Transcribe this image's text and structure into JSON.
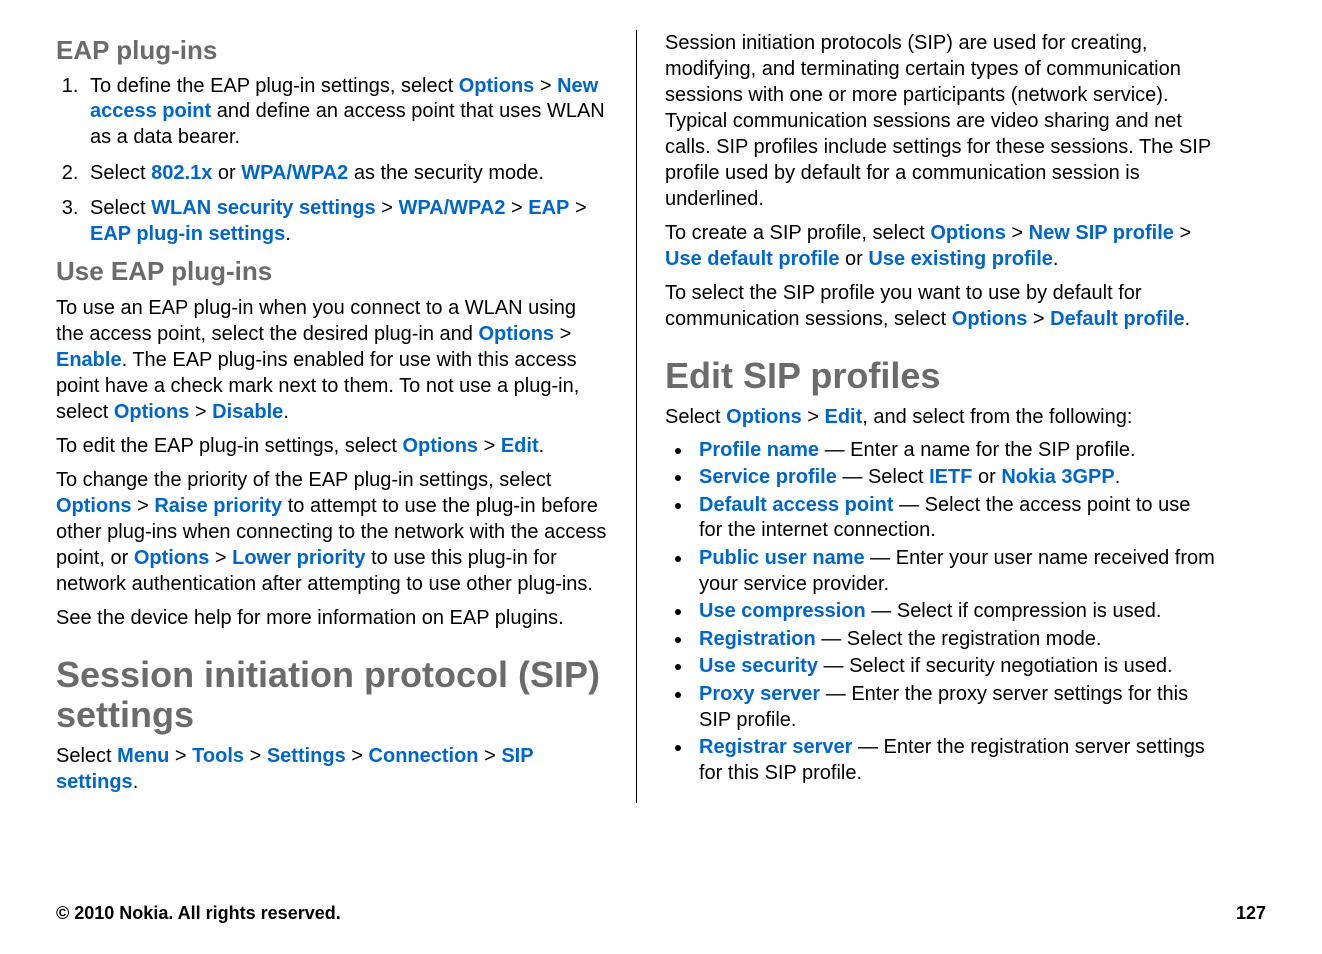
{
  "left": {
    "h1": "EAP plug-ins",
    "steps": [
      {
        "pre": "To define the EAP plug-in settings, select ",
        "b1": "Options",
        "mid1": "  >  ",
        "b2": "New access point",
        "post": " and define an access point that uses WLAN as a data bearer."
      },
      {
        "pre": "Select ",
        "b1": "802.1x",
        "mid1": " or ",
        "b2": "WPA/WPA2",
        "post": " as the security mode."
      },
      {
        "pre": "Select ",
        "b1": "WLAN security settings",
        "mid1": "  >  ",
        "b2": "WPA/WPA2",
        "mid2": "  >  ",
        "b3": "EAP",
        "mid3": "  >  ",
        "b4": "EAP plug-in settings",
        "post": "."
      }
    ],
    "h2": "Use EAP plug-ins",
    "p1": {
      "t1": "To use an EAP plug-in when you connect to a WLAN using the access point, select the desired plug-in and ",
      "b1": "Options",
      "t2": "  >  ",
      "b2": "Enable",
      "t3": ". The EAP plug-ins enabled for use with this access point have a check mark next to them. To not use a plug-in, select ",
      "b3": "Options",
      "t4": "  >  ",
      "b4": "Disable",
      "t5": "."
    },
    "p2": {
      "t1": "To edit the EAP plug-in settings, select ",
      "b1": "Options",
      "t2": "  >  ",
      "b2": "Edit",
      "t3": "."
    },
    "p3": {
      "t1": "To change the priority of the EAP plug-in settings, select ",
      "b1": "Options",
      "t2": "  >  ",
      "b2": "Raise priority",
      "t3": " to attempt to use the plug-in before other plug-ins when connecting to the network with the access point, or ",
      "b3": "Options",
      "t4": "  >  ",
      "b4": "Lower priority",
      "t5": " to use this plug-in for network authentication after attempting to use other plug-ins."
    },
    "p4": "See the device help for more information on EAP plugins.",
    "h3": "Session initiation protocol (SIP) settings",
    "p5": {
      "t1": "Select ",
      "b1": "Menu",
      "t2": " > ",
      "b2": "Tools",
      "t3": " > ",
      "b3": "Settings",
      "t4": " > ",
      "b4": "Connection",
      "t5": " > ",
      "b5": "SIP settings",
      "t6": "."
    }
  },
  "right": {
    "p1": "Session initiation protocols (SIP) are used for creating, modifying, and terminating certain types of communication sessions with one or more participants (network service). Typical communication sessions are video sharing and net calls. SIP profiles include settings for these sessions. The SIP profile used by default for a communication session is underlined.",
    "p2": {
      "t1": "To create a SIP profile, select ",
      "b1": "Options",
      "t2": "  >  ",
      "b2": "New SIP profile",
      "t3": "  >  ",
      "b3": "Use default profile",
      "t4": " or ",
      "b4": "Use existing profile",
      "t5": "."
    },
    "p3": {
      "t1": "To select the SIP profile you want to use by default for communication sessions, select ",
      "b1": "Options",
      "t2": "  >  ",
      "b2": "Default profile",
      "t3": "."
    },
    "h1": "Edit SIP profiles",
    "p4": {
      "t1": "Select ",
      "b1": "Options",
      "t2": "  >  ",
      "b2": "Edit",
      "t3": ", and select from the following:"
    },
    "items": [
      {
        "b": "Profile name",
        "t": " — Enter a name for the SIP profile."
      },
      {
        "b": "Service profile",
        "pre": " — Select ",
        "b2": "IETF",
        "mid": " or ",
        "b3": "Nokia 3GPP",
        "post": "."
      },
      {
        "b": "Default access point",
        "t": " — Select the access point to use for the internet connection."
      },
      {
        "b": "Public user name",
        "t": " — Enter your user name received from your service provider."
      },
      {
        "b": "Use compression",
        "t": " — Select if compression is used."
      },
      {
        "b": "Registration",
        "t": " — Select the registration mode."
      },
      {
        "b": "Use security",
        "t": " — Select if security negotiation is used."
      },
      {
        "b": "Proxy server",
        "t": " — Enter the proxy server settings for this SIP profile."
      },
      {
        "b": "Registrar server",
        "t": " — Enter the registration server settings for this SIP profile."
      }
    ]
  },
  "footer": {
    "copyright": "© 2010 Nokia. All rights reserved.",
    "page": "127"
  }
}
